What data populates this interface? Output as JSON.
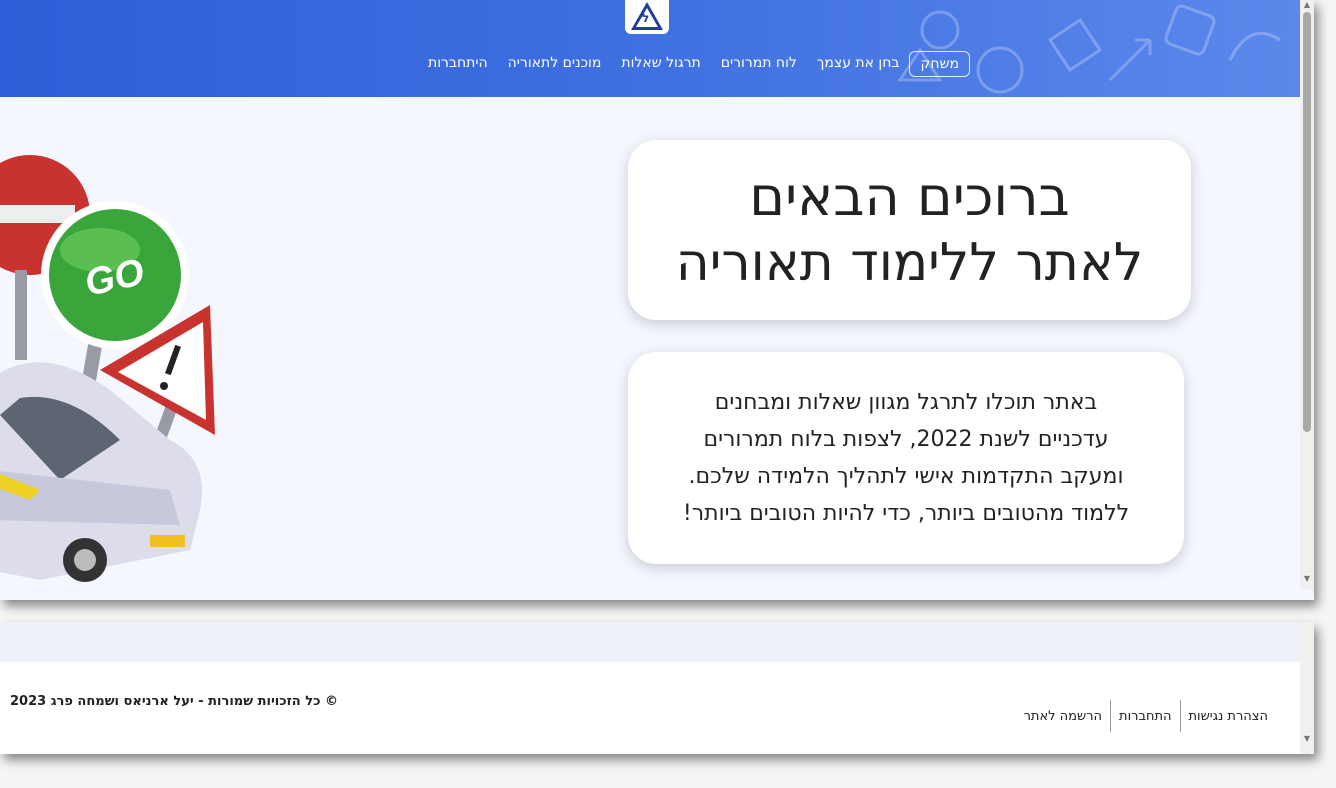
{
  "navbar": {
    "logo_letter": "ל",
    "links": [
      {
        "label": "משחק",
        "boxed": true
      },
      {
        "label": "בחן את עצמך",
        "boxed": false
      },
      {
        "label": "לוח תמרורים",
        "boxed": false
      },
      {
        "label": "תרגול שאלות",
        "boxed": false
      },
      {
        "label": "מוכנים לתאוריה",
        "boxed": false
      },
      {
        "label": "היתחברות",
        "boxed": false
      }
    ]
  },
  "hero": {
    "welcome_line1": "ברוכים הבאים",
    "welcome_line2": "לאתר ללימוד תאוריה",
    "desc_lines": [
      "באתר תוכלו לתרגל מגוון שאלות ומבחנים",
      "עדכניים לשנת 2022, לצפות בלוח תמרורים",
      "ומעקב התקדמות אישי לתהליך הלמידה שלכם.",
      "ללמוד מהטובים ביותר, כדי להיות הטובים ביותר!"
    ],
    "illustration": {
      "go_sign_text": "GO",
      "icons": [
        "no-entry-sign",
        "go-sign",
        "warning-sign",
        "car"
      ]
    }
  },
  "footer": {
    "links": [
      "הצהרת נגישות",
      "התחברות",
      "הרשמה לאתר"
    ],
    "copyright": "© כל הזכויות שמורות - יעל ארניאס ושמחה פרג 2023"
  },
  "colors": {
    "navbar_start": "#2f5fd8",
    "navbar_end": "#5b88ea",
    "page_bg": "#f5f7ff",
    "card_bg": "#ffffff"
  }
}
